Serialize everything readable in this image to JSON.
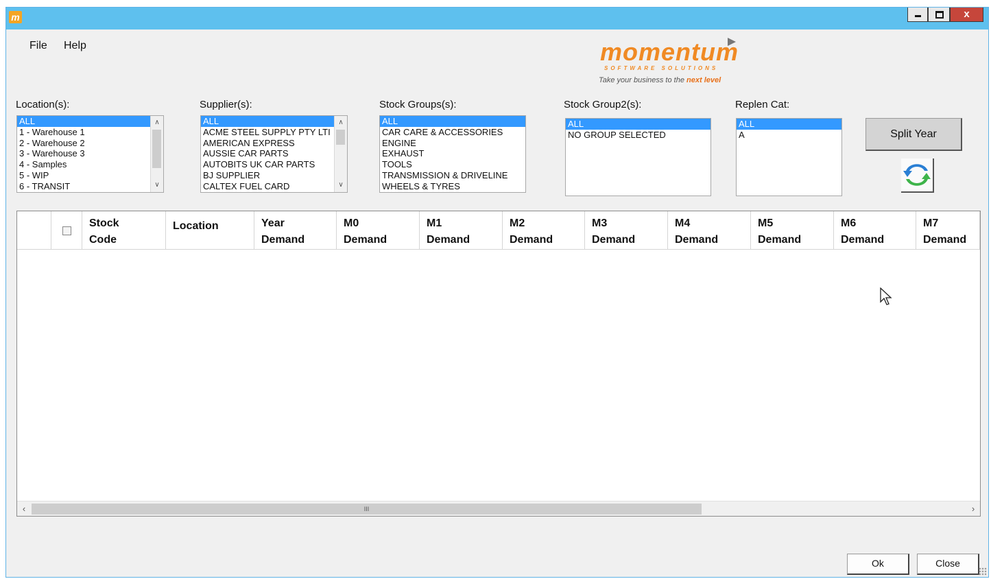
{
  "window": {
    "icon_letter": "m",
    "controls": {
      "minimize": "minimize",
      "maximize": "maximize",
      "close": "x"
    }
  },
  "menu": {
    "file": "File",
    "help": "Help"
  },
  "logo": {
    "word": "momentum",
    "sub": "SOFTWARE SOLUTIONS",
    "tagline_prefix": "Take your business to the ",
    "tagline_highlight": "next level",
    "brand_color": "#f08a24"
  },
  "filters": {
    "locations": {
      "label": "Location(s):",
      "items": [
        "ALL",
        "1 - Warehouse 1",
        "2 - Warehouse 2",
        "3 - Warehouse 3",
        "4 - Samples",
        "5 - WIP",
        "6 - TRANSIT"
      ]
    },
    "suppliers": {
      "label": "Supplier(s):",
      "items": [
        "ALL",
        "ACME STEEL SUPPLY PTY LTI",
        "AMERICAN EXPRESS",
        "AUSSIE CAR PARTS",
        "AUTOBITS UK CAR PARTS",
        "BJ SUPPLIER",
        "CALTEX FUEL CARD"
      ]
    },
    "stock_groups": {
      "label": "Stock Groups(s):",
      "items": [
        "ALL",
        "CAR CARE & ACCESSORIES",
        "ENGINE",
        "EXHAUST",
        "TOOLS",
        "TRANSMISSION & DRIVELINE",
        "WHEELS & TYRES"
      ]
    },
    "stock_group2": {
      "label": "Stock Group2(s):",
      "items": [
        "ALL",
        "NO GROUP SELECTED"
      ]
    },
    "replen_cat": {
      "label": "Replen Cat:",
      "items": [
        "ALL",
        "A"
      ]
    },
    "selection_color": "#3399ff"
  },
  "actions": {
    "split_year": "Split Year",
    "refresh_icon": "refresh-arrows-icon"
  },
  "grid": {
    "columns": [
      {
        "line1": "Stock",
        "line2": "Code"
      },
      {
        "line1": "Location",
        "line2": ""
      },
      {
        "line1": "Year",
        "line2": "Demand"
      },
      {
        "line1": "M0",
        "line2": "Demand"
      },
      {
        "line1": "M1",
        "line2": "Demand"
      },
      {
        "line1": "M2",
        "line2": "Demand"
      },
      {
        "line1": "M3",
        "line2": "Demand"
      },
      {
        "line1": "M4",
        "line2": "Demand"
      },
      {
        "line1": "M5",
        "line2": "Demand"
      },
      {
        "line1": "M6",
        "line2": "Demand"
      },
      {
        "line1": "M7",
        "line2": "Demand"
      }
    ],
    "rows": [],
    "scroll_thumb_glyph": "III"
  },
  "dialog": {
    "ok": "Ok",
    "close": "Close"
  }
}
